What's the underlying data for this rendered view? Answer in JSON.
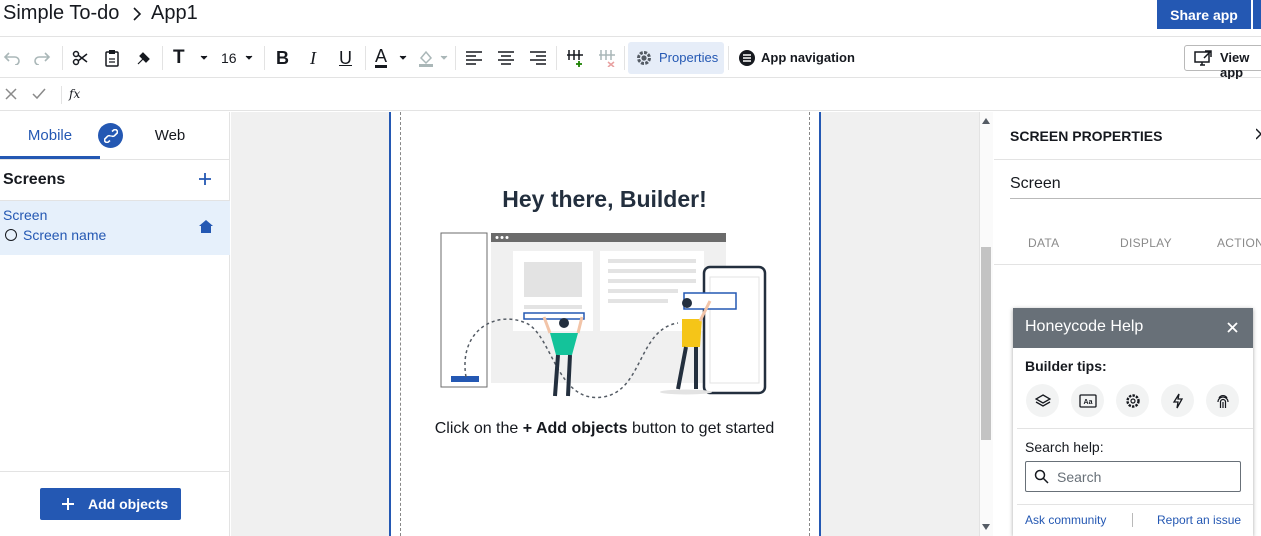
{
  "breadcrumb": {
    "app": "Simple To-do",
    "page": "App1"
  },
  "header": {
    "share_label": "Share app"
  },
  "toolbar": {
    "font_icon_label": "T",
    "font_size": "16",
    "bold_label": "B",
    "italic_label": "I",
    "underline_label": "U",
    "text_color_label": "A",
    "properties_label": "Properties",
    "app_nav_label": "App navigation",
    "view_app_label": "View app"
  },
  "formula": {
    "fx_label": "fx"
  },
  "left_panel": {
    "tabs": [
      {
        "label": "Mobile"
      },
      {
        "label": "Web"
      }
    ],
    "screens_title": "Screens",
    "screen_item": {
      "title": "Screen",
      "name": "Screen name"
    },
    "add_objects_label": "Add objects"
  },
  "canvas": {
    "greeting": "Hey there, Builder!",
    "hint_pre": "Click on the ",
    "hint_bold": "+ Add objects",
    "hint_post": " button to get started"
  },
  "right_panel": {
    "title": "SCREEN PROPERTIES",
    "screen_value": "Screen",
    "tabs": [
      {
        "label": "DATA"
      },
      {
        "label": "DISPLAY"
      },
      {
        "label": "ACTIONS"
      }
    ]
  },
  "help": {
    "title": "Honeycode Help",
    "tips_label": "Builder tips:",
    "tip_icons": [
      "layers-icon",
      "text-format-icon",
      "gear-icon",
      "lightning-icon",
      "fingerprint-icon"
    ],
    "search_label": "Search help:",
    "search_placeholder": "Search",
    "ask_label": "Ask community",
    "report_label": "Report an issue"
  },
  "colors": {
    "accent": "#2458b3",
    "help_header": "#687078",
    "selected_bg": "#e6f0fb",
    "figure_teal": "#14c39a",
    "figure_yellow": "#f5c518"
  }
}
